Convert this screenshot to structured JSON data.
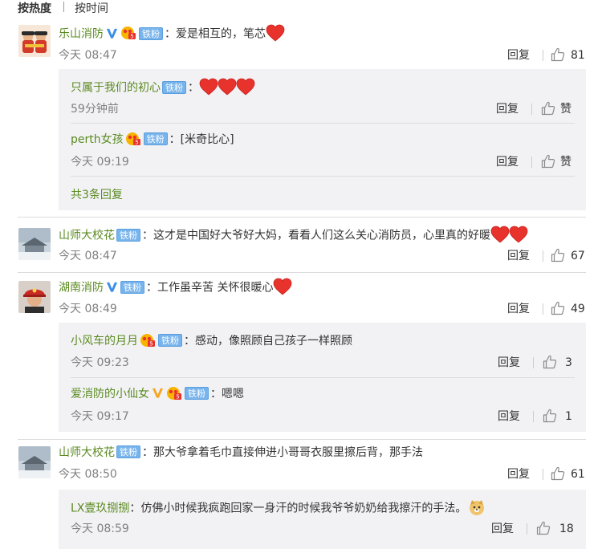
{
  "sort": {
    "hot": "按热度",
    "time": "按时间"
  },
  "labels": {
    "reply": "回复",
    "fan_badge": "铁粉"
  },
  "comments": [
    {
      "user": "乐山消防",
      "text": "：爱是相互的，笔芯",
      "time": "今天 08:47",
      "likes": "81",
      "replies": [
        {
          "user": "只属于我们的初心",
          "text": "：",
          "time": "59分钟前",
          "likes": "赞"
        },
        {
          "user": "perth女孩",
          "text": "：[米奇比心]",
          "time": "今天 09:19",
          "likes": "赞"
        }
      ],
      "more": "共3条回复"
    },
    {
      "user": "山师大校花",
      "text": "：这才是中国好大爷好大妈，看看人们这么关心消防员，心里真的好暖",
      "time": "今天 08:47",
      "likes": "67"
    },
    {
      "user": "湖南消防",
      "text": "：工作虽辛苦 关怀很暖心",
      "time": "今天 08:49",
      "likes": "49",
      "replies": [
        {
          "user": "小风车的月月",
          "text": "：感动，像照顾自己孩子一样照顾",
          "time": "今天 09:23",
          "likes": "3"
        },
        {
          "user": "爱消防的小仙女",
          "text": "：嗯嗯",
          "time": "今天 09:17",
          "likes": "1"
        }
      ]
    },
    {
      "user": "山师大校花",
      "text": "：那大爷拿着毛巾直接伸进小哥哥衣服里擦后背，那手法",
      "time": "今天 08:50",
      "likes": "61",
      "replies": [
        {
          "user": "LX壹玖捌捌",
          "text": "：仿佛小时候我疯跑回家一身汗的时候我爷爷奶奶给我擦汗的手法。",
          "time": "今天 08:59",
          "likes": "18"
        }
      ]
    }
  ],
  "colors": {
    "username": "#5a8a1f",
    "time": "#808080",
    "reply_bg": "#f2f2f5",
    "badge": "#78b4ec",
    "heart": "#e8332d",
    "vip": "#f5a623"
  }
}
